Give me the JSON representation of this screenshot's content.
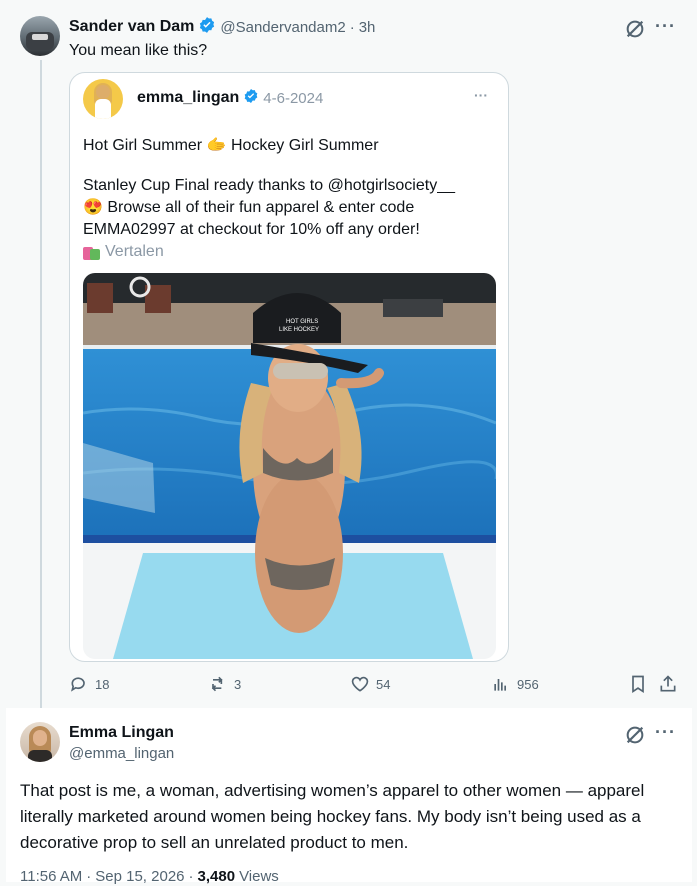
{
  "reply": {
    "author_name": "Sander van Dam",
    "author_handle": "@Sandervandam2",
    "separator": "·",
    "time": "3h",
    "text": "You mean like this?"
  },
  "quote": {
    "author_name": "emma_lingan",
    "date": "4-6-2024",
    "line1": "Hot Girl Summer 🫱 Hockey Girl Summer",
    "line2": "Stanley Cup Final ready thanks to @hotgirlsociety__",
    "line3": "😍 Browse all of their fun apparel & enter code",
    "line4": "EMMA02997 at checkout for 10% off any order!",
    "translate_label": "Vertalen",
    "cap_text_1": "HOT GIRLS",
    "cap_text_2": "LIKE HOCKEY"
  },
  "actions": {
    "replies": "18",
    "reposts": "3",
    "likes": "54",
    "views": "956"
  },
  "main": {
    "author_name": "Emma Lingan",
    "author_handle": "@emma_lingan",
    "text": "That post is me, a woman, advertising women’s apparel to other women — apparel literally marketed around women being hockey fans. My body isn’t being used as a decorative prop to sell an unrelated product to men.",
    "time": "11:56 AM",
    "dot1": "·",
    "date": "Sep 15, 2026",
    "dot2": "·",
    "views_count": "3,480",
    "views_label": "Views"
  },
  "colors": {
    "verified": "#1d9bf0",
    "secondary_text": "#536471",
    "border": "#cfd9de"
  }
}
